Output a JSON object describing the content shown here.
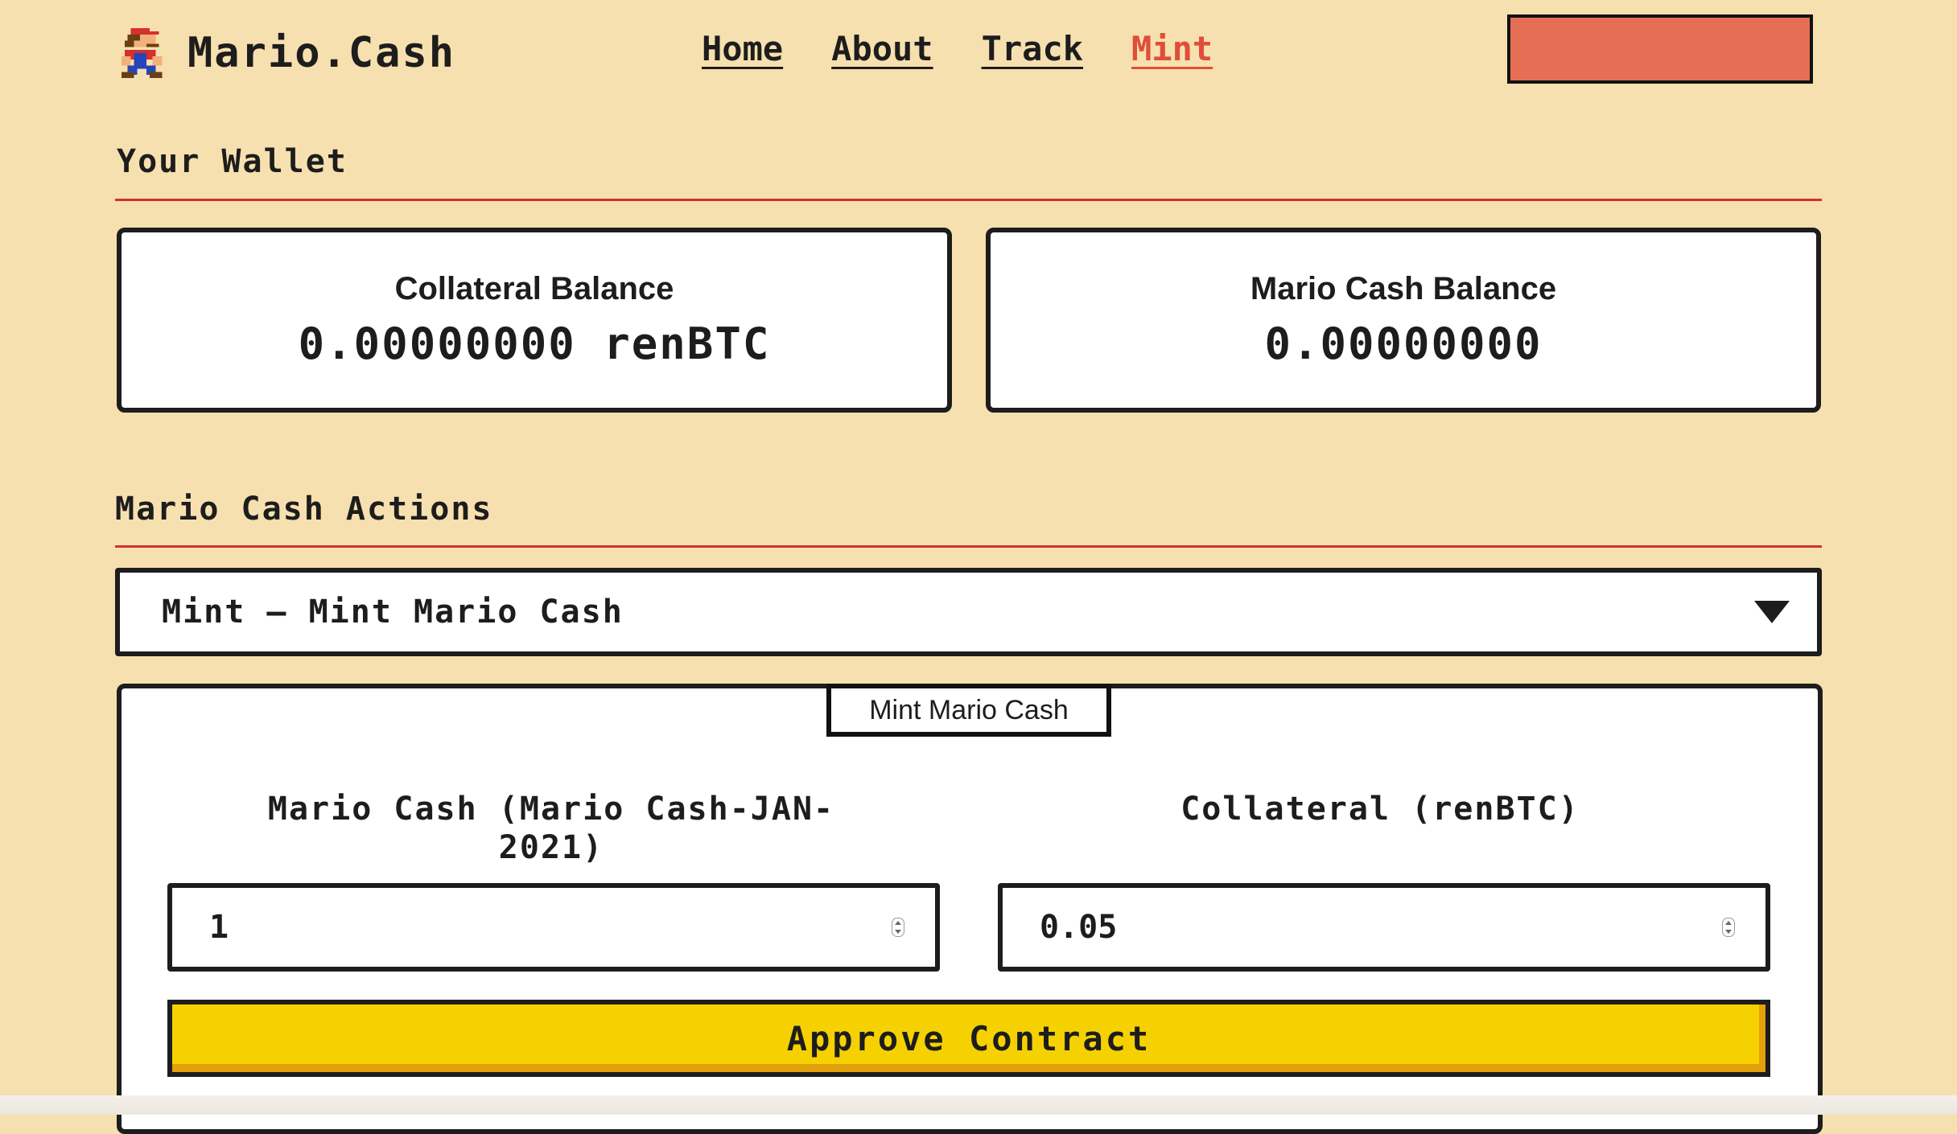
{
  "header": {
    "brand": "Mario.Cash",
    "nav": [
      {
        "label": "Home",
        "active": false
      },
      {
        "label": "About",
        "active": false
      },
      {
        "label": "Track",
        "active": false
      },
      {
        "label": "Mint",
        "active": true
      }
    ],
    "connect_button_label": ""
  },
  "wallet": {
    "title": "Your Wallet",
    "collateral": {
      "label": "Collateral Balance",
      "value": "0.00000000 renBTC"
    },
    "mario_cash": {
      "label": "Mario Cash Balance",
      "value": "0.00000000"
    }
  },
  "actions": {
    "title": "Mario Cash Actions",
    "selected_action": "Mint — Mint Mario Cash",
    "form": {
      "legend": "Mint Mario Cash",
      "mario_cash_label": "Mario Cash (Mario Cash-JAN-2021)",
      "mario_cash_value": "1",
      "collateral_label": "Collateral (renBTC)",
      "collateral_value": "0.05",
      "approve_label": "Approve Contract"
    }
  },
  "colors": {
    "background": "#f7e0af",
    "accent_red": "#e04e39",
    "connect_button": "#e46f55",
    "rule": "#d0312d",
    "approve_yellow": "#f6d101"
  },
  "icons": {
    "logo": "mario-sprite-icon",
    "select_caret": "caret-down-icon"
  }
}
